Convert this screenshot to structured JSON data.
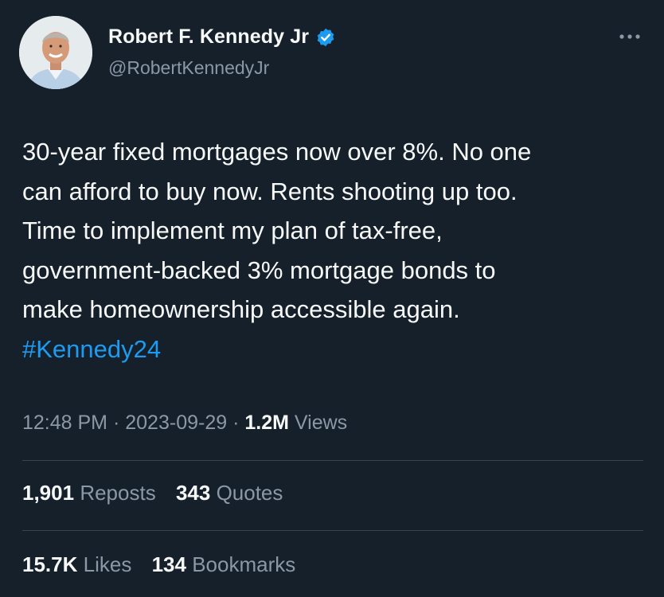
{
  "author": {
    "display_name": "Robert F. Kennedy Jr",
    "handle": "@RobertKennedyJr",
    "verified": true
  },
  "tweet": {
    "text": "30-year fixed mortgages now over 8%. No one\ncan afford to buy now. Rents shooting up too.\nTime to implement my plan of tax-free,\ngovernment-backed 3% mortgage bonds to\nmake homeownership accessible again.",
    "hashtag": "#Kennedy24"
  },
  "meta": {
    "time": "12:48 PM",
    "separator": "·",
    "date": "2023-09-29",
    "views_count": "1.2M",
    "views_label": "Views"
  },
  "stats": {
    "reposts_count": "1,901",
    "reposts_label": "Reposts",
    "quotes_count": "343",
    "quotes_label": "Quotes",
    "likes_count": "15.7K",
    "likes_label": "Likes",
    "bookmarks_count": "134",
    "bookmarks_label": "Bookmarks"
  },
  "colors": {
    "background": "#15202b",
    "text": "#f7f9f9",
    "secondary": "#8b98a5",
    "accent": "#1d9bf0",
    "divider": "#38444d"
  },
  "icons": {
    "verified": "verified-badge-icon",
    "more": "more-options-icon"
  }
}
